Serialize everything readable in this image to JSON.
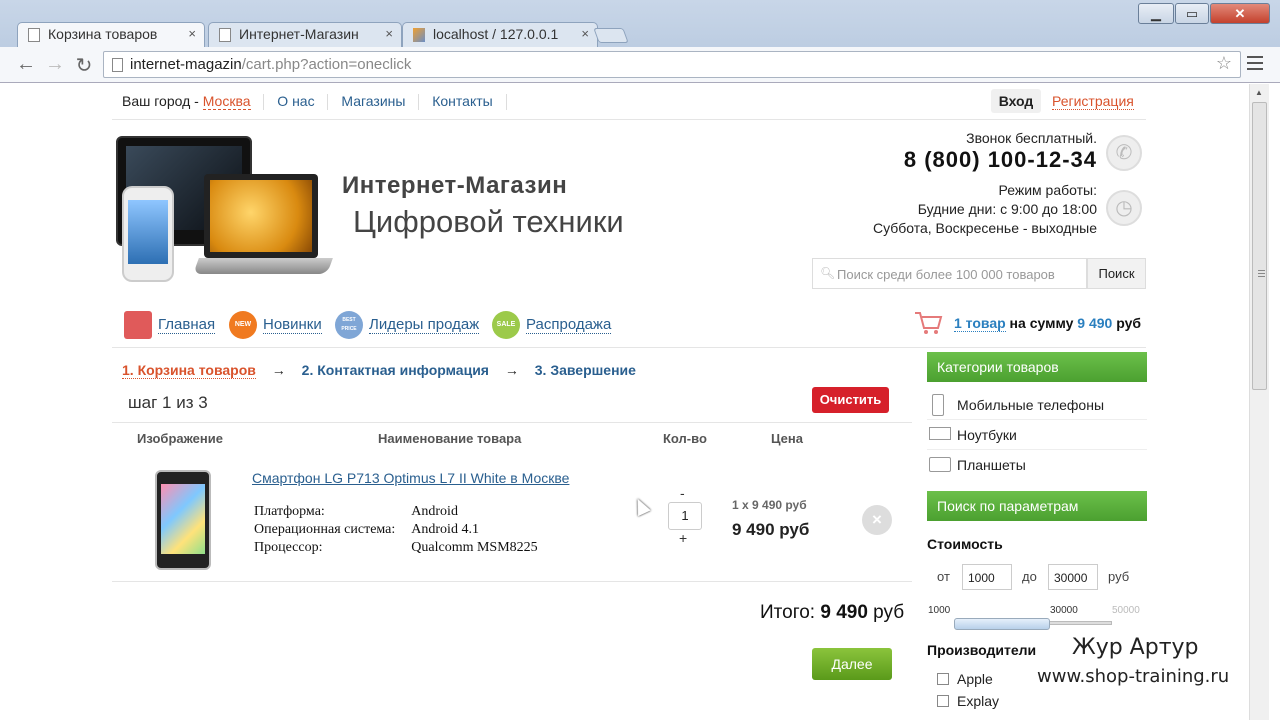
{
  "browser": {
    "tabs": [
      {
        "label": "Корзина товаров",
        "close": "×"
      },
      {
        "label": "Интернет-Магазин",
        "close": "×"
      },
      {
        "label": "localhost / 127.0.0.1",
        "close": "×"
      }
    ],
    "url_host": "internet-magazin",
    "url_path": "/cart.php?action=oneclick",
    "window_buttons": {
      "minimize": "▁",
      "maximize": "▭",
      "close": "✕"
    }
  },
  "topbar": {
    "city_label": "Ваш город - ",
    "city": "Москва",
    "links": [
      "О нас",
      "Магазины",
      "Контакты"
    ],
    "login": "Вход",
    "register": "Регистрация"
  },
  "header": {
    "brand_line1": "Интернет-Магазин",
    "brand_line2": "Цифровой техники",
    "free_call": "Звонок бесплатный.",
    "phone": "8 (800) 100-12-34",
    "hours_title": "Режим работы:",
    "hours_weekdays": "Будние дни: с 9:00 до 18:00",
    "hours_weekend": "Суббота, Воскресенье - выходные",
    "search_placeholder": "Поиск среди более 100 000 товаров",
    "search_button": "Поиск"
  },
  "menu": {
    "items": [
      {
        "label": "Главная",
        "badge": ""
      },
      {
        "label": "Новинки",
        "badge": "NEW"
      },
      {
        "label": "Лидеры продаж",
        "badge": "BEST PRICE"
      },
      {
        "label": "Распродажа",
        "badge": "SALE"
      }
    ],
    "cart_count": "1 товар",
    "cart_on_sum": " на сумму ",
    "cart_sum": "9 490",
    "cart_currency": " руб"
  },
  "cart": {
    "steps": [
      "1. Корзина товаров",
      "2. Контактная информация",
      "3. Завершение"
    ],
    "arrow": "→",
    "step_of": "шаг 1 из 3",
    "clear_button": "Очистить",
    "columns": [
      "Изображение",
      "Наименование товара",
      "Кол-во",
      "Цена"
    ],
    "product": {
      "name": "Смартфон LG P713 Optimus L7 II White в Москве",
      "specs": [
        {
          "key": "Платформа:",
          "value": "Android"
        },
        {
          "key": "Операционная система:",
          "value": "Android 4.1"
        },
        {
          "key": "Процессор:",
          "value": "Qualcomm MSM8225"
        }
      ],
      "minus": "-",
      "qty": "1",
      "plus": "+",
      "unit_price": "1 x 9 490 руб",
      "line_price": "9 490 руб",
      "remove": "×"
    },
    "total_label": "Итого: ",
    "total_value": "9 490",
    "total_currency": " руб",
    "next_button": "Далее"
  },
  "sidebar": {
    "categories_title": "Категории товаров",
    "categories": [
      "Мобильные телефоны",
      "Ноутбуки",
      "Планшеты"
    ],
    "params_title": "Поиск по параметрам",
    "price_label": "Стоимость",
    "from_label": "от",
    "from_value": "1000",
    "to_label": "до",
    "to_value": "30000",
    "currency": "руб",
    "slider_min": "1000",
    "slider_value": "30000",
    "slider_max": "50000",
    "manufacturers_label": "Производители",
    "manufacturers": [
      "Apple",
      "Explay"
    ]
  },
  "watermark": {
    "name": "Жур Артур",
    "site": "www.shop-training.ru"
  }
}
